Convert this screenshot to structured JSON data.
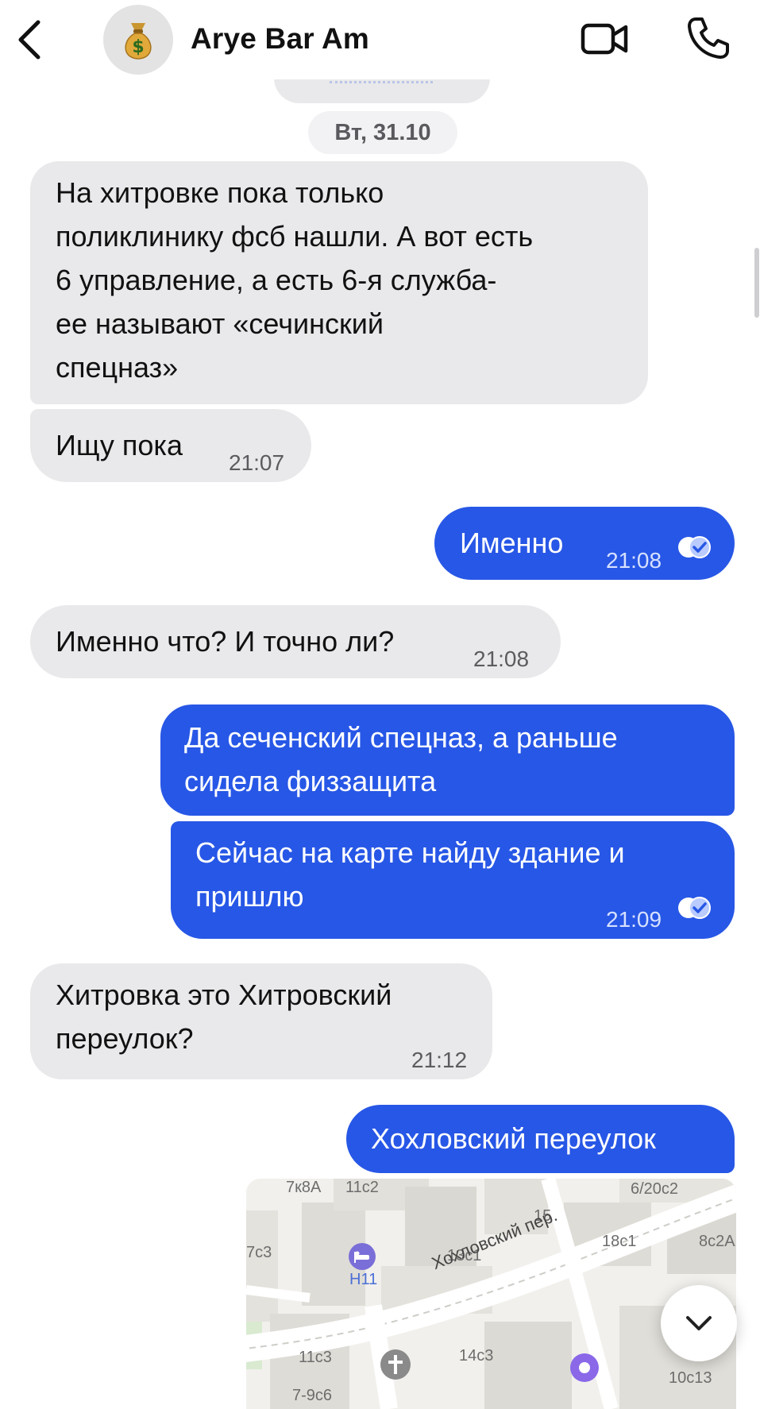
{
  "header": {
    "contact_name": "Arye Bar Am",
    "avatar_emoji": "💰"
  },
  "date_separator": "Вт, 31.10",
  "colors": {
    "incoming_bubble": "#e9e9eb",
    "outgoing_bubble": "#2757e6",
    "background": "#ffffff"
  },
  "messages": [
    {
      "direction": "incoming",
      "lines": [
        "На хитровке пока только",
        "поликлинику фсб нашли. А вот есть",
        "6 управление,  а есть 6-я служба-",
        "ее называют «сечинский",
        "спецназ»"
      ],
      "time": ""
    },
    {
      "direction": "incoming",
      "text": "Ищу пока",
      "time": "21:07"
    },
    {
      "direction": "outgoing",
      "text": "Именно",
      "time": "21:08",
      "status": "read"
    },
    {
      "direction": "incoming",
      "text": "Именно что? И точно ли?",
      "time": "21:08"
    },
    {
      "direction": "outgoing",
      "lines": [
        "Да сеченский спецназ, а раньше",
        "сидела физзащита"
      ],
      "time": ""
    },
    {
      "direction": "outgoing",
      "lines": [
        "Сейчас на карте найду здание и",
        "пришлю"
      ],
      "time": "21:09",
      "status": "read"
    },
    {
      "direction": "incoming",
      "lines": [
        "Хитровка это Хитровский",
        "переулок?"
      ],
      "time": "21:12"
    },
    {
      "direction": "outgoing",
      "text": "Хохловский переулок",
      "time": ""
    }
  ],
  "map": {
    "street_label": "Хохловский пер.",
    "labels": [
      "7к8А",
      "11с2",
      "6/20с2",
      "15",
      "7с3",
      "18с1",
      "8с2А",
      "13с1",
      "Н11",
      "11с3",
      "14с3",
      "10с13",
      "7-9с6"
    ],
    "icons": [
      "hotel-icon",
      "church-icon",
      "location-pin-icon"
    ]
  },
  "icons": [
    "back-chevron-icon",
    "video-call-icon",
    "phone-icon",
    "chevron-down-icon",
    "read-checks-icon"
  ]
}
